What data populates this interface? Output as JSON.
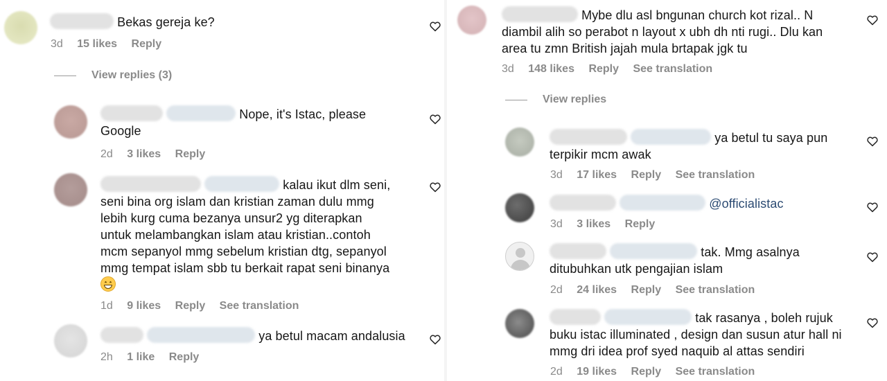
{
  "left": {
    "comments": [
      {
        "text": "Bekas gereja ke?",
        "time": "3d",
        "likes": "15 likes",
        "reply": "Reply",
        "view_replies": "View replies (3)"
      },
      {
        "text": "Nope, it's Istac, please",
        "text2": "Google",
        "time": "2d",
        "likes": "3 likes",
        "reply": "Reply"
      },
      {
        "line1": "kalau ikut dlm seni,",
        "line2": "seni bina org islam dan kristian zaman dulu mmg",
        "line3": "lebih kurg cuma bezanya unsur2 yg diterapkan",
        "line4": "untuk melambangkan islam atau kristian..contoh",
        "line5": "mcm sepanyol mmg sebelum kristian dtg, sepanyol",
        "line6": "mmg tempat islam sbb tu berkait rapat seni binanya",
        "time": "1d",
        "likes": "9 likes",
        "reply": "Reply",
        "translate": "See translation"
      },
      {
        "text": "ya betul macam andalusia",
        "time": "2h",
        "likes": "1 like",
        "reply": "Reply"
      }
    ]
  },
  "right": {
    "comments": [
      {
        "line1": "Mybe dlu asl bngunan church kot rizal.. N",
        "line2": "diambil alih so perabot n layout x ubh dh nti rugi.. Dlu kan",
        "line3": "area tu zmn British jajah mula brtapak jgk tu",
        "time": "3d",
        "likes": "148 likes",
        "reply": "Reply",
        "translate": "See translation",
        "view_replies": "View replies"
      },
      {
        "line1": "ya betul tu saya pun",
        "line2": "terpikir mcm awak",
        "time": "3d",
        "likes": "17 likes",
        "reply": "Reply",
        "translate": "See translation"
      },
      {
        "mention": "@officialistac",
        "time": "3d",
        "likes": "3 likes",
        "reply": "Reply"
      },
      {
        "line1": "tak. Mmg asalnya",
        "line2": "ditubuhkan utk pengajian islam",
        "time": "2d",
        "likes": "24 likes",
        "reply": "Reply",
        "translate": "See translation"
      },
      {
        "line1": "tak rasanya , boleh rujuk",
        "line2": "buku istac illuminated , design dan susun atur hall ni",
        "line3": "mmg dri idea prof syed naquib al attas sendiri",
        "time": "2d",
        "likes": "19 likes",
        "reply": "Reply",
        "translate": "See translation"
      }
    ]
  },
  "icons": {
    "like": "heart-outline-icon",
    "emoji": "grinning-face-emoji",
    "default_avatar": "default-user-avatar-icon"
  }
}
